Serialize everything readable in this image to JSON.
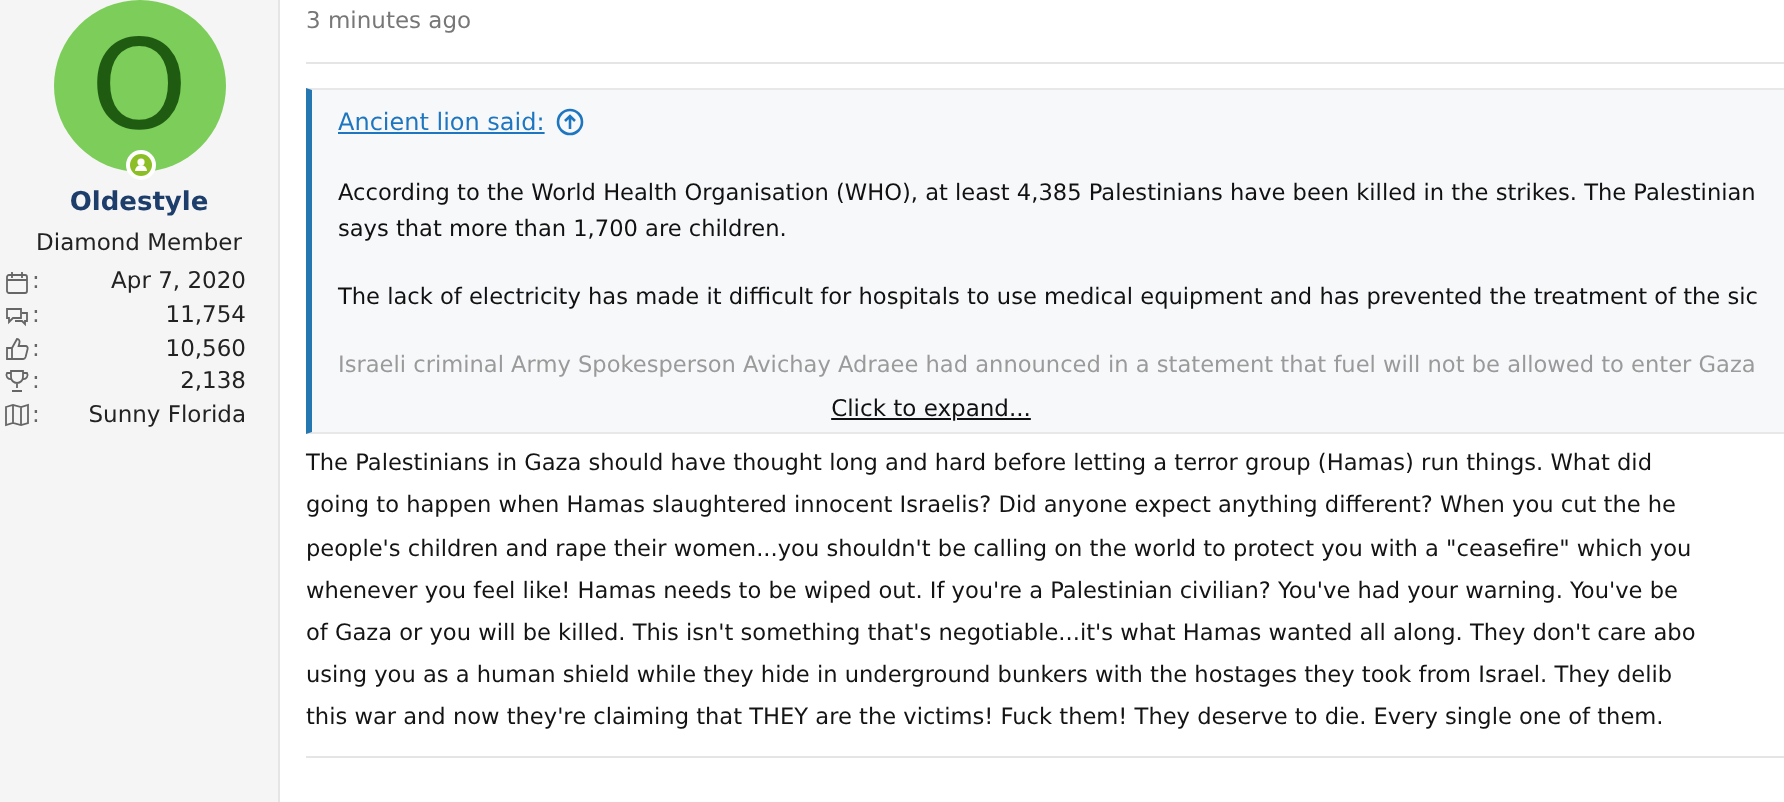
{
  "user": {
    "initial": "O",
    "online": true,
    "name": "Oldestyle",
    "title": "Diamond Member",
    "stats": [
      {
        "kind": "joined",
        "label": ":",
        "value": "Apr 7, 2020"
      },
      {
        "kind": "messages",
        "label": ":",
        "value": "11,754"
      },
      {
        "kind": "reactions",
        "label": ":",
        "value": "10,560"
      },
      {
        "kind": "points",
        "label": ":",
        "value": "2,138"
      },
      {
        "kind": "location",
        "label": ":",
        "value": "Sunny Florida"
      }
    ]
  },
  "post": {
    "time": "3 minutes ago",
    "quote": {
      "author": "Ancient lion said:",
      "paragraphs": [
        {
          "faded": false,
          "lines": [
            "According to the World Health Organisation (WHO), at least 4,385 Palestinians have been killed in the strikes. The Palestinian",
            "says that more than 1,700 are children."
          ]
        },
        {
          "faded": false,
          "lines": [
            "The lack of electricity has made it difficult for hospitals to use medical equipment and has prevented the treatment of the sic"
          ]
        },
        {
          "faded": true,
          "lines": [
            "Israeli criminal Army Spokesperson Avichay Adraee had announced in a statement that fuel will not be allowed to enter Gaza"
          ]
        }
      ],
      "expand": "Click to expand..."
    },
    "body": [
      "The Palestinians in Gaza should have thought long and hard before letting a terror group (Hamas) run things. What did",
      "going to happen when Hamas slaughtered innocent Israelis? Did anyone expect anything different? When you cut the he",
      "people's children and rape their women...you shouldn't be calling on the world to protect you with a \"ceasefire\" which you",
      "whenever you feel like! Hamas needs to be wiped out. If you're a Palestinian civilian? You've had your warning. You've be",
      "of Gaza or you will be killed. This isn't something that's negotiable...it's what Hamas wanted all along. They don't care abo",
      "using you as a human shield while they hide in underground bunkers with the hostages they took from Israel. They delib",
      "this war and now they're claiming that THEY are the victims! Fuck them! They deserve to die. Every single one of them."
    ]
  }
}
